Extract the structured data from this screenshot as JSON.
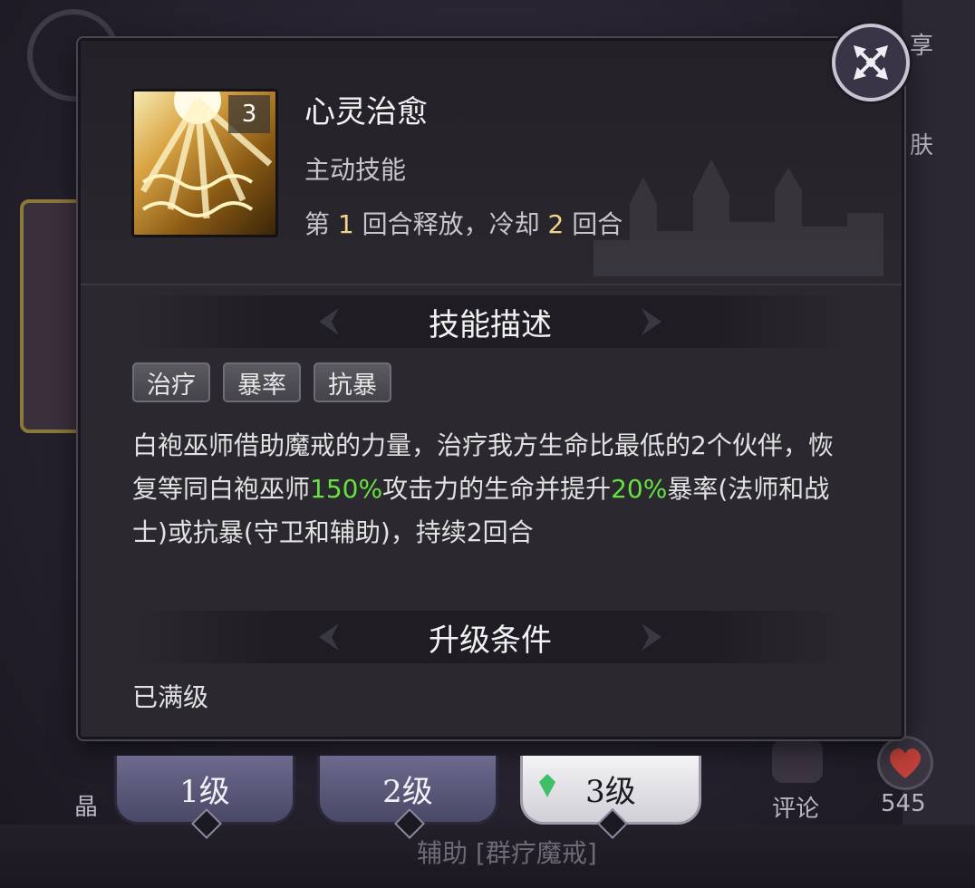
{
  "background": {
    "right_top_label": "享",
    "right_mid_label": "肤",
    "bottom_left_label": "晶",
    "bottom_strip_text": "辅助 [群疗魔戒]",
    "comment_label": "评论",
    "like_count": "545"
  },
  "skill": {
    "level_badge": "3",
    "name": "心灵治愈",
    "type": "主动技能",
    "cd_prefix": "第 ",
    "release_round": "1",
    "cd_middle": " 回合释放，冷却 ",
    "cooldown": "2",
    "cd_suffix": " 回合"
  },
  "description_section": {
    "title": "技能描述",
    "tags": [
      "治疗",
      "暴率",
      "抗暴"
    ],
    "text_part1": "白袍巫师借助魔戒的力量，治疗我方生命比最低的2个伙伴，恢复等同白袍巫师",
    "highlight1": "150%",
    "text_part2": "攻击力的生命并提升",
    "highlight2": "20%",
    "text_part3": "暴率(法师和战士)或抗暴(守卫和辅助)，持续2回合"
  },
  "upgrade_section": {
    "title": "升级条件",
    "status": "已满级"
  },
  "level_tabs": [
    {
      "label": "1级",
      "active": false
    },
    {
      "label": "2级",
      "active": false
    },
    {
      "label": "3级",
      "active": true
    }
  ],
  "colors": {
    "highlight_green": "#66e240",
    "number_gold": "#f3d48a"
  }
}
